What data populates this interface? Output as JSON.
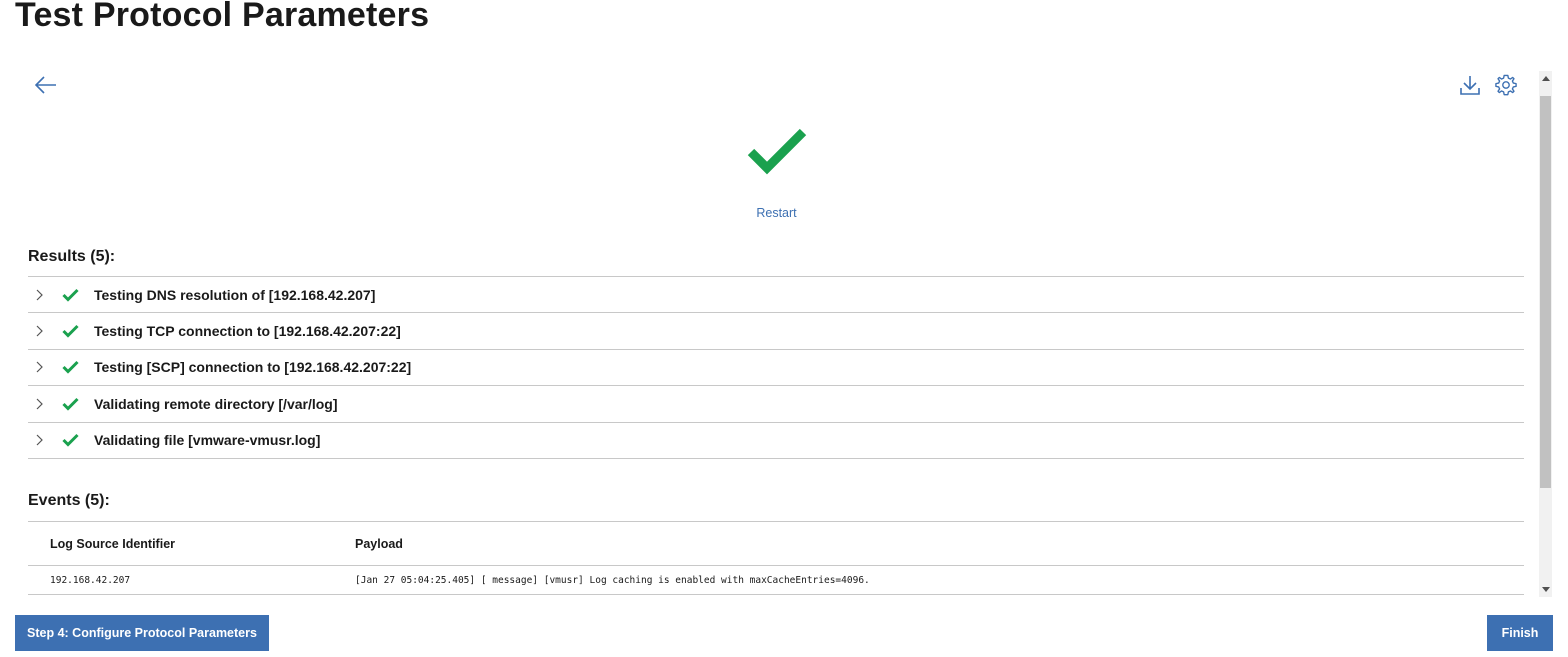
{
  "page": {
    "title": "Test Protocol Parameters"
  },
  "toolbar": {
    "back_icon": "arrow-left-icon",
    "download_icon": "download-icon",
    "settings_icon": "gear-icon"
  },
  "status": {
    "icon": "checkmark-icon",
    "color": "#1aa14e",
    "restart_label": "Restart"
  },
  "results": {
    "heading": "Results (5):",
    "items": [
      {
        "label": "Testing DNS resolution of [192.168.42.207]",
        "status": "success"
      },
      {
        "label": "Testing TCP connection to [192.168.42.207:22]",
        "status": "success"
      },
      {
        "label": "Testing [SCP] connection to [192.168.42.207:22]",
        "status": "success"
      },
      {
        "label": "Validating remote directory [/var/log]",
        "status": "success"
      },
      {
        "label": "Validating file [vmware-vmusr.log]",
        "status": "success"
      }
    ]
  },
  "events": {
    "heading": "Events (5):",
    "columns": [
      "Log Source Identifier",
      "Payload"
    ],
    "rows": [
      {
        "source": "192.168.42.207",
        "payload": "[Jan 27 05:04:25.405] [ message] [vmusr] Log caching is enabled with maxCacheEntries=4096."
      }
    ]
  },
  "footer": {
    "step_button": "Step 4: Configure Protocol Parameters",
    "finish_button": "Finish"
  },
  "colors": {
    "accent": "#3d70b2",
    "success": "#1aa14e"
  }
}
